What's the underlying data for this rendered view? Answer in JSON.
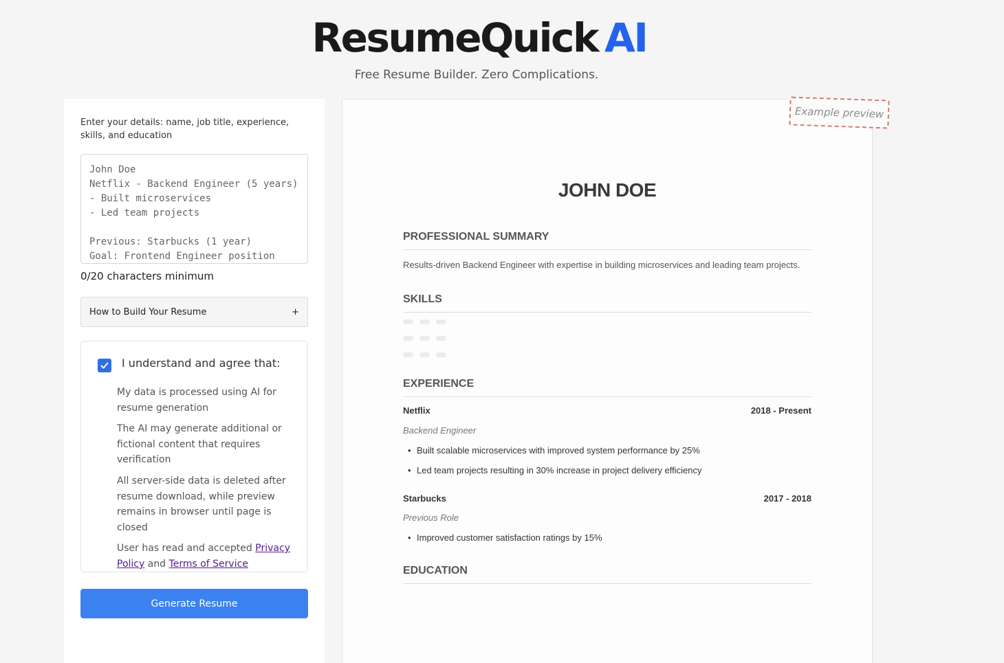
{
  "header": {
    "logo_main": "ResumeQuick",
    "logo_accent": "AI",
    "tagline": "Free Resume Builder. Zero Complications."
  },
  "form": {
    "instructions": "Enter your details: name, job title, experience, skills, and education",
    "details_placeholder": "John Doe\nNetflix - Backend Engineer (5 years)\n- Built microservices\n- Led team projects\n\nPrevious: Starbucks (1 year)\nGoal: Frontend Engineer position",
    "char_count": "0/20 characters minimum",
    "howto_label": "How to Build Your Resume",
    "howto_toggle": "+",
    "consent": {
      "checked": true,
      "title": "I understand and agree that:",
      "items": [
        "My data is processed using AI for resume generation",
        "The AI may generate additional or fictional content that requires verification",
        "All server-side data is deleted after resume download, while preview remains in browser until page is closed"
      ],
      "policy_prefix": "User has read and accepted",
      "privacy_link": "Privacy Policy",
      "and_text": "and",
      "terms_link": "Terms of Service"
    },
    "generate_label": "Generate Resume"
  },
  "preview": {
    "stamp": "Example preview",
    "name": "JOHN DOE",
    "sections": {
      "summary": "PROFESSIONAL SUMMARY",
      "skills": "SKILLS",
      "experience": "EXPERIENCE",
      "education": "EDUCATION"
    },
    "summary_text": "Results-driven Backend Engineer with expertise in building microservices and leading team projects.",
    "jobs": [
      {
        "company": "Netflix",
        "dates": "2018 - Present",
        "role": "Backend Engineer",
        "bullets": [
          "Built scalable microservices with improved system performance by 25%",
          "Led team projects resulting in 30% increase in project delivery efficiency"
        ]
      },
      {
        "company": "Starbucks",
        "dates": "2017 - 2018",
        "role": "Previous Role",
        "bullets": [
          "Improved customer satisfaction ratings by 15%"
        ]
      }
    ]
  },
  "colors": {
    "accent": "#2463eb",
    "button": "#3b82f0",
    "stamp_border": "#d2786a"
  }
}
